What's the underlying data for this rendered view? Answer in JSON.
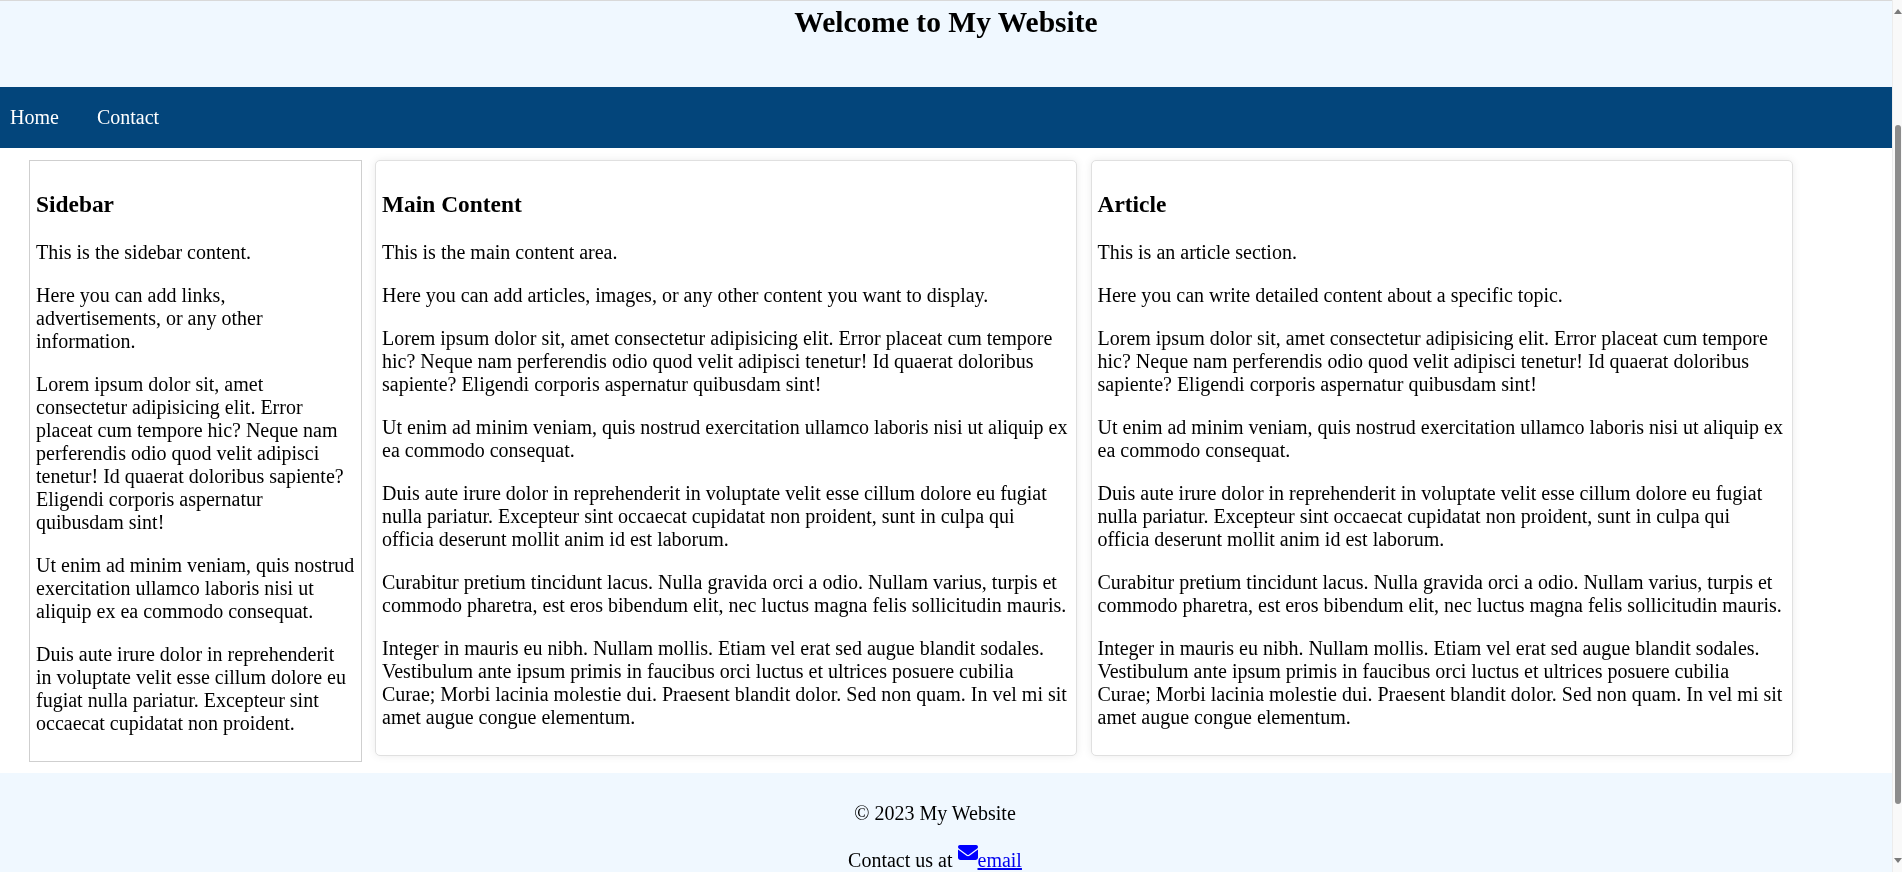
{
  "header": {
    "title": "Welcome to My Website"
  },
  "nav": {
    "links": [
      {
        "label": "Home"
      },
      {
        "label": "Contact"
      }
    ]
  },
  "sections": [
    {
      "kind": "sidebar",
      "heading": "Sidebar",
      "paragraphs": [
        "This is the sidebar content.",
        "Here you can add links, advertisements, or any other information.",
        "Lorem ipsum dolor sit, amet consectetur adipisicing elit. Error placeat cum tempore hic? Neque nam perferendis odio quod velit adipisci tenetur! Id quaerat doloribus sapiente? Eligendi corporis aspernatur quibusdam sint!",
        "Ut enim ad minim veniam, quis nostrud exercitation ullamco laboris nisi ut aliquip ex ea commodo consequat.",
        "Duis aute irure dolor in reprehenderit in voluptate velit esse cillum dolore eu fugiat nulla pariatur. Excepteur sint occaecat cupidatat non proident."
      ]
    },
    {
      "kind": "main",
      "heading": "Main Content",
      "paragraphs": [
        "This is the main content area.",
        "Here you can add articles, images, or any other content you want to display.",
        "Lorem ipsum dolor sit, amet consectetur adipisicing elit. Error placeat cum tempore hic? Neque nam perferendis odio quod velit adipisci tenetur! Id quaerat doloribus sapiente? Eligendi corporis aspernatur quibusdam sint!",
        "Ut enim ad minim veniam, quis nostrud exercitation ullamco laboris nisi ut aliquip ex ea commodo consequat.",
        "Duis aute irure dolor in reprehenderit in voluptate velit esse cillum dolore eu fugiat nulla pariatur. Excepteur sint occaecat cupidatat non proident, sunt in culpa qui officia deserunt mollit anim id est laborum.",
        "Curabitur pretium tincidunt lacus. Nulla gravida orci a odio. Nullam varius, turpis et commodo pharetra, est eros bibendum elit, nec luctus magna felis sollicitudin mauris.",
        "Integer in mauris eu nibh. Nullam mollis. Etiam vel erat sed augue blandit sodales. Vestibulum ante ipsum primis in faucibus orci luctus et ultrices posuere cubilia Curae; Morbi lacinia molestie dui. Praesent blandit dolor. Sed non quam. In vel mi sit amet augue congue elementum."
      ]
    },
    {
      "kind": "article",
      "heading": "Article",
      "paragraphs": [
        "This is an article section.",
        "Here you can write detailed content about a specific topic.",
        "Lorem ipsum dolor sit, amet consectetur adipisicing elit. Error placeat cum tempore hic? Neque nam perferendis odio quod velit adipisci tenetur! Id quaerat doloribus sapiente? Eligendi corporis aspernatur quibusdam sint!",
        "Ut enim ad minim veniam, quis nostrud exercitation ullamco laboris nisi ut aliquip ex ea commodo consequat.",
        "Duis aute irure dolor in reprehenderit in voluptate velit esse cillum dolore eu fugiat nulla pariatur. Excepteur sint occaecat cupidatat non proident, sunt in culpa qui officia deserunt mollit anim id est laborum.",
        "Curabitur pretium tincidunt lacus. Nulla gravida orci a odio. Nullam varius, turpis et commodo pharetra, est eros bibendum elit, nec luctus magna felis sollicitudin mauris.",
        "Integer in mauris eu nibh. Nullam mollis. Etiam vel erat sed augue blandit sodales. Vestibulum ante ipsum primis in faucibus orci luctus et ultrices posuere cubilia Curae; Morbi lacinia molestie dui. Praesent blandit dolor. Sed non quam. In vel mi sit amet augue congue elementum."
      ]
    }
  ],
  "footer": {
    "copyright": "© 2023 My Website",
    "contact_text": "Contact us at",
    "contact_link": "email"
  }
}
